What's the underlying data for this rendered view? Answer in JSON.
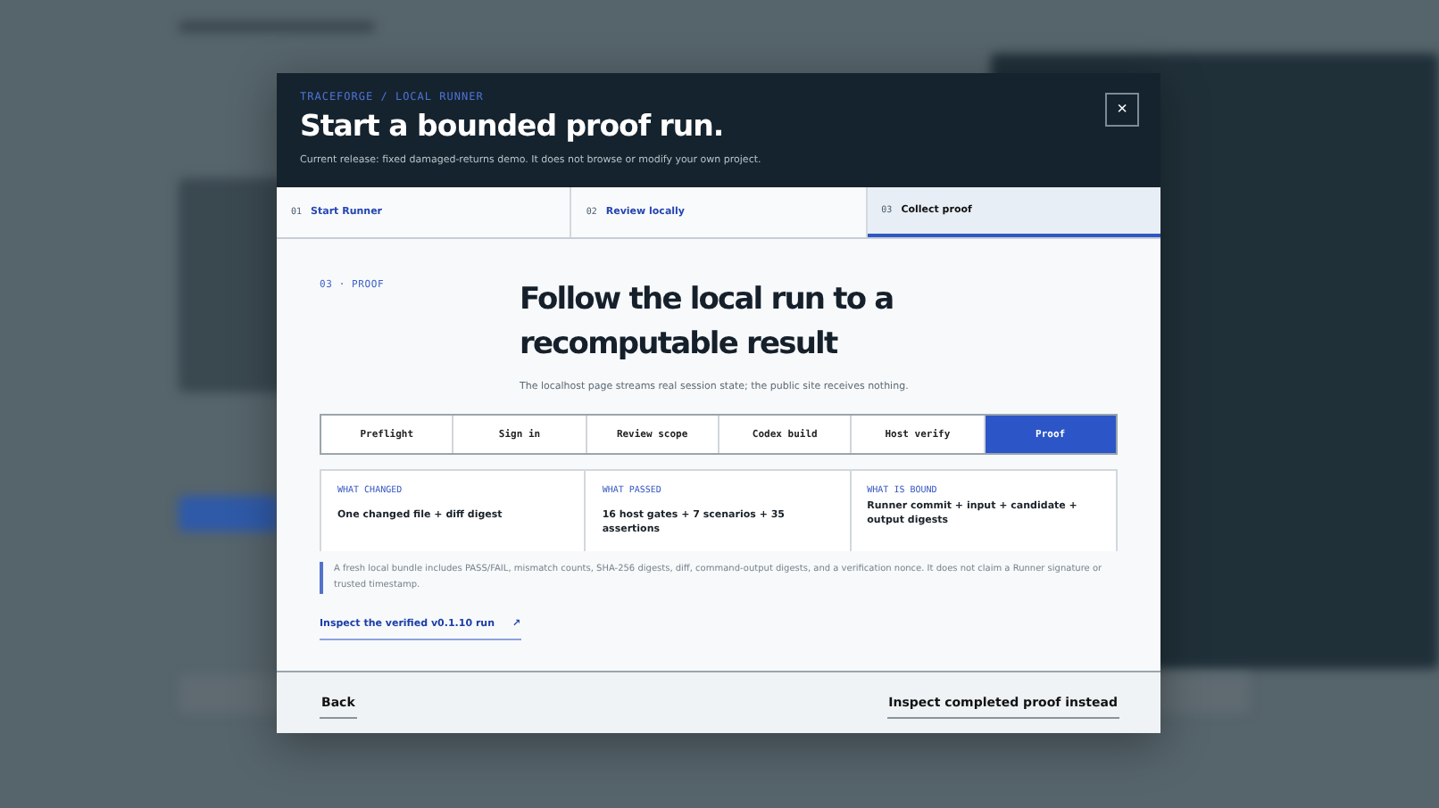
{
  "modal": {
    "eyebrow": "TRACEFORGE / LOCAL RUNNER",
    "title": "Start a bounded proof run.",
    "subtitle": "Current release: fixed damaged-returns demo. It does not browse or modify your own project.",
    "close": "×",
    "steps": [
      {
        "number": "01",
        "label": "Start Runner",
        "selected": false
      },
      {
        "number": "02",
        "label": "Review locally",
        "selected": false
      },
      {
        "number": "03",
        "label": "Collect proof",
        "selected": true
      }
    ],
    "section_label": "03 · PROOF",
    "heading": "Follow the local run to a recomputable result",
    "lead": "The localhost page streams real session state; the public site receives nothing.",
    "stages": [
      {
        "label": "Preflight",
        "selected": false
      },
      {
        "label": "Sign in",
        "selected": false
      },
      {
        "label": "Review scope",
        "selected": false
      },
      {
        "label": "Codex build",
        "selected": false
      },
      {
        "label": "Host verify",
        "selected": false
      },
      {
        "label": "Proof",
        "selected": true
      }
    ],
    "facts": [
      {
        "label": "WHAT CHANGED",
        "value": "One changed file + diff digest"
      },
      {
        "label": "WHAT PASSED",
        "value": "16 host gates + 7 scenarios + 35 assertions"
      },
      {
        "label": "WHAT IS BOUND",
        "value": "Runner commit + input + candidate + output digests"
      }
    ],
    "note": "A fresh local bundle includes PASS/FAIL, mismatch counts, SHA-256 digests, diff, command-output digests, and a verification nonce. It does not claim a Runner signature or trusted timestamp.",
    "link": {
      "label": "Inspect the verified v0.1.10 run",
      "arrow": "↗"
    },
    "back": "Back",
    "alternate": "Inspect completed proof instead"
  }
}
